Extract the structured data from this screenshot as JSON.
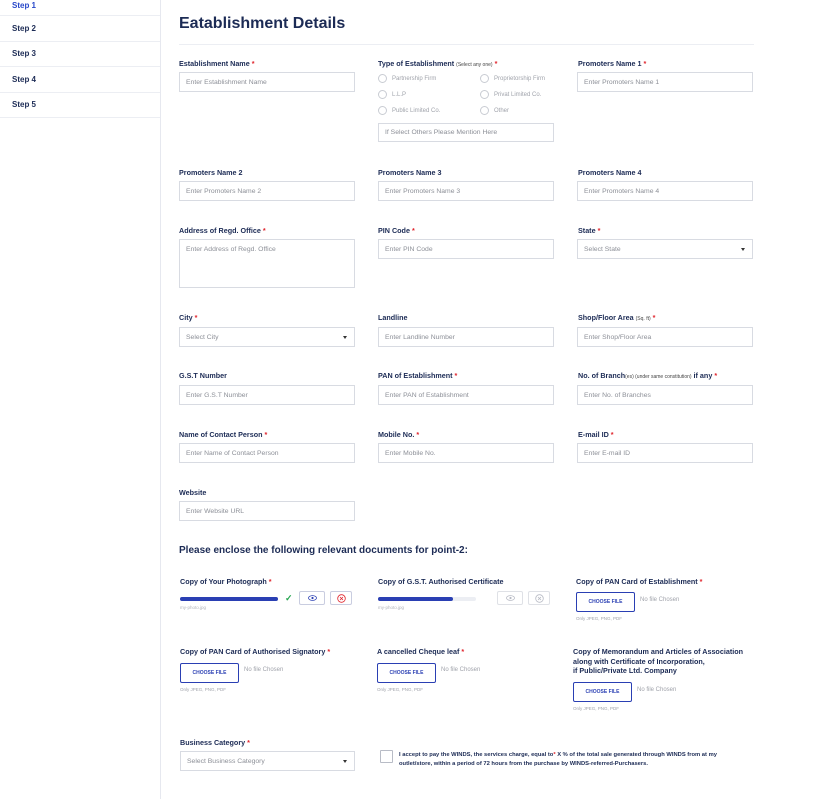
{
  "sidebar": {
    "steps": [
      "Step 1",
      "Step 2",
      "Step 3",
      "Step 4",
      "Step 5"
    ]
  },
  "page": {
    "title": "Eatablishment Details"
  },
  "fields": {
    "establishment_name": {
      "label": "Establishment Name",
      "placeholder": "Enter Establishment Name"
    },
    "type": {
      "label": "Type of Establishment",
      "hint": "(Select any one)",
      "options": [
        "Partnership Firm",
        "Proprietorship Firm",
        "L.L.P",
        "Privat Limited Co.",
        "Public Limited Co.",
        "Other"
      ],
      "other_placeholder": "If Select Others Please Mention Here"
    },
    "promoter1": {
      "label": "Promoters Name 1",
      "placeholder": "Enter Promoters Name 1"
    },
    "promoter2": {
      "label": "Promoters Name 2",
      "placeholder": "Enter Promoters Name 2"
    },
    "promoter3": {
      "label": "Promoters Name 3",
      "placeholder": "Enter Promoters Name 3"
    },
    "promoter4": {
      "label": "Promoters Name 4",
      "placeholder": "Enter Promoters Name 4"
    },
    "address": {
      "label": "Address of Regd. Office",
      "placeholder": "Enter Address of Regd. Office"
    },
    "pin": {
      "label": "PIN Code",
      "placeholder": "Enter PIN Code"
    },
    "state": {
      "label": "State",
      "value": "Select State"
    },
    "city": {
      "label": "City",
      "value": "Select City"
    },
    "landline": {
      "label": "Landline",
      "placeholder": "Enter Landline Number"
    },
    "area": {
      "label": "Shop/Floor Area",
      "unit": "(Sq. ft)",
      "placeholder": "Enter Shop/Floor Area"
    },
    "gst": {
      "label": "G.S.T Number",
      "placeholder": "Enter G.S.T Number"
    },
    "pan": {
      "label": "PAN of Establishment",
      "placeholder": "Enter PAN of Establishment"
    },
    "branches": {
      "label_a": "No. of Branch",
      "label_b": "(es) (under same constitution)",
      "label_c": " if any",
      "placeholder": "Enter No. of Branches"
    },
    "contact": {
      "label": "Name of Contact Person",
      "placeholder": "Enter Name of Contact Person"
    },
    "mobile": {
      "label": "Mobile No.",
      "placeholder": "Enter Mobile No."
    },
    "email": {
      "label": "E-mail ID",
      "placeholder": "Enter E-mail ID"
    },
    "website": {
      "label": "Website",
      "placeholder": "Enter Website URL"
    }
  },
  "documents": {
    "heading": "Please enclose the following relevant documents for point-2:",
    "photo": {
      "label": "Copy of Your Photograph",
      "filename": "my-photo.jpg",
      "progress": 1.0
    },
    "gst_cert": {
      "label": "Copy of G.S.T. Authorised Certificate",
      "filename": "my-photo.jpg",
      "progress": 0.77
    },
    "pan_card": {
      "label": "Copy of PAN Card of Establishment"
    },
    "pan_signatory": {
      "label": "Copy of PAN Card of Authorised Signatory"
    },
    "cheque": {
      "label": "A cancelled Cheque leaf"
    },
    "moa": {
      "line1": "Copy of Memorandum and Articles of  Association",
      "line2": "along with Certificate of Incorporation,",
      "line3": "if Public/Private Ltd. Company"
    },
    "choose_label": "CHOOSE FILE",
    "no_file": "No file Chosen",
    "hint": "Only JPEG, PNG, PDF"
  },
  "business": {
    "label": "Business Category",
    "value": "Select Business Category"
  },
  "consent": {
    "part1": "I accept to pay the WINDS, the services charge, equal to",
    "part2": "  X % of the total sale generated through WINDS from at my outlet/store, within a period of 72 hours from the purchase by WINDS-referred-Purchasers."
  },
  "required_mark": "*",
  "colors": {
    "accent": "#2a3fb3",
    "title": "#1c2b55",
    "required": "#e0242c",
    "success": "#26a550"
  },
  "icons": {
    "eye": "eye-icon",
    "remove": "close-circle-icon",
    "check": "check-icon",
    "caret": "chevron-down-icon"
  }
}
